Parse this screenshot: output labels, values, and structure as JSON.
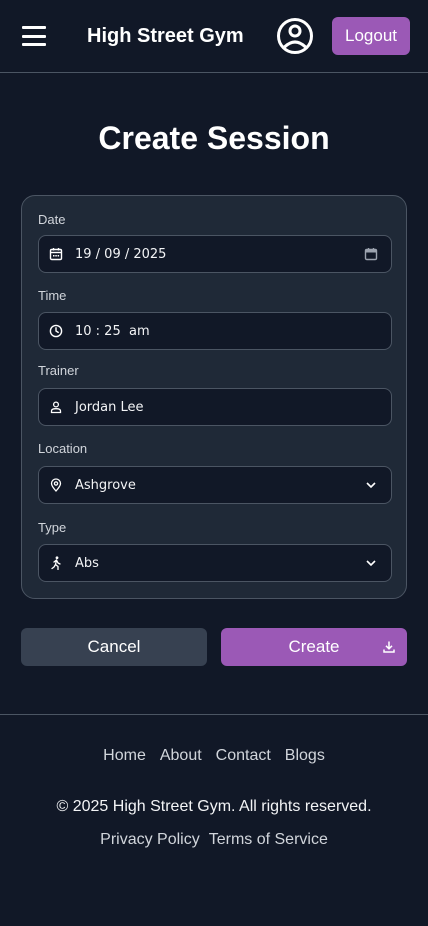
{
  "header": {
    "brand": "High Street Gym",
    "logout_label": "Logout",
    "menu_icon": "hamburger-menu-icon",
    "avatar_icon": "user-circle-icon"
  },
  "page": {
    "title": "Create Session"
  },
  "form": {
    "date": {
      "label": "Date",
      "value": "19 / 09 / 2025",
      "icon": "calendar-icon"
    },
    "time": {
      "label": "Time",
      "value": "10 : 25  am",
      "icon": "clock-icon"
    },
    "trainer": {
      "label": "Trainer",
      "value": "Jordan Lee",
      "icon": "person-icon"
    },
    "location": {
      "label": "Location",
      "value": "Ashgrove",
      "icon": "map-pin-icon"
    },
    "type": {
      "label": "Type",
      "value": "Abs",
      "icon": "running-person-icon"
    }
  },
  "actions": {
    "cancel_label": "Cancel",
    "create_label": "Create",
    "create_icon": "download-icon"
  },
  "footer": {
    "nav": [
      "Home",
      "About",
      "Contact",
      "Blogs"
    ],
    "copyright": "© 2025 High Street Gym. All rights reserved.",
    "links": [
      "Privacy Policy",
      "Terms of Service"
    ]
  },
  "colors": {
    "background": "#111827",
    "card": "#1f2937",
    "accent": "#9b59b6",
    "cancel": "#374151",
    "border": "#4b5563"
  }
}
